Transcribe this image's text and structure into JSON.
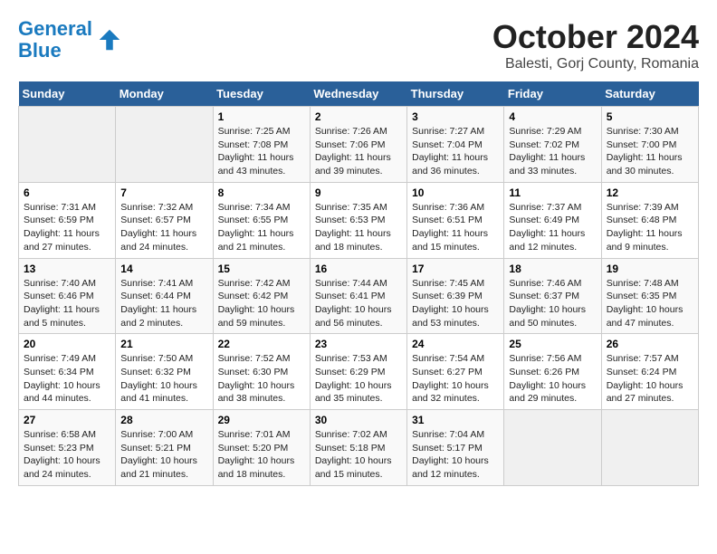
{
  "header": {
    "logo_line1": "General",
    "logo_line2": "Blue",
    "month": "October 2024",
    "location": "Balesti, Gorj County, Romania"
  },
  "days_of_week": [
    "Sunday",
    "Monday",
    "Tuesday",
    "Wednesday",
    "Thursday",
    "Friday",
    "Saturday"
  ],
  "weeks": [
    [
      {
        "day": "",
        "empty": true
      },
      {
        "day": "",
        "empty": true
      },
      {
        "day": "1",
        "sunrise": "7:25 AM",
        "sunset": "7:08 PM",
        "daylight": "11 hours and 43 minutes."
      },
      {
        "day": "2",
        "sunrise": "7:26 AM",
        "sunset": "7:06 PM",
        "daylight": "11 hours and 39 minutes."
      },
      {
        "day": "3",
        "sunrise": "7:27 AM",
        "sunset": "7:04 PM",
        "daylight": "11 hours and 36 minutes."
      },
      {
        "day": "4",
        "sunrise": "7:29 AM",
        "sunset": "7:02 PM",
        "daylight": "11 hours and 33 minutes."
      },
      {
        "day": "5",
        "sunrise": "7:30 AM",
        "sunset": "7:00 PM",
        "daylight": "11 hours and 30 minutes."
      }
    ],
    [
      {
        "day": "6",
        "sunrise": "7:31 AM",
        "sunset": "6:59 PM",
        "daylight": "11 hours and 27 minutes."
      },
      {
        "day": "7",
        "sunrise": "7:32 AM",
        "sunset": "6:57 PM",
        "daylight": "11 hours and 24 minutes."
      },
      {
        "day": "8",
        "sunrise": "7:34 AM",
        "sunset": "6:55 PM",
        "daylight": "11 hours and 21 minutes."
      },
      {
        "day": "9",
        "sunrise": "7:35 AM",
        "sunset": "6:53 PM",
        "daylight": "11 hours and 18 minutes."
      },
      {
        "day": "10",
        "sunrise": "7:36 AM",
        "sunset": "6:51 PM",
        "daylight": "11 hours and 15 minutes."
      },
      {
        "day": "11",
        "sunrise": "7:37 AM",
        "sunset": "6:49 PM",
        "daylight": "11 hours and 12 minutes."
      },
      {
        "day": "12",
        "sunrise": "7:39 AM",
        "sunset": "6:48 PM",
        "daylight": "11 hours and 9 minutes."
      }
    ],
    [
      {
        "day": "13",
        "sunrise": "7:40 AM",
        "sunset": "6:46 PM",
        "daylight": "11 hours and 5 minutes."
      },
      {
        "day": "14",
        "sunrise": "7:41 AM",
        "sunset": "6:44 PM",
        "daylight": "11 hours and 2 minutes."
      },
      {
        "day": "15",
        "sunrise": "7:42 AM",
        "sunset": "6:42 PM",
        "daylight": "10 hours and 59 minutes."
      },
      {
        "day": "16",
        "sunrise": "7:44 AM",
        "sunset": "6:41 PM",
        "daylight": "10 hours and 56 minutes."
      },
      {
        "day": "17",
        "sunrise": "7:45 AM",
        "sunset": "6:39 PM",
        "daylight": "10 hours and 53 minutes."
      },
      {
        "day": "18",
        "sunrise": "7:46 AM",
        "sunset": "6:37 PM",
        "daylight": "10 hours and 50 minutes."
      },
      {
        "day": "19",
        "sunrise": "7:48 AM",
        "sunset": "6:35 PM",
        "daylight": "10 hours and 47 minutes."
      }
    ],
    [
      {
        "day": "20",
        "sunrise": "7:49 AM",
        "sunset": "6:34 PM",
        "daylight": "10 hours and 44 minutes."
      },
      {
        "day": "21",
        "sunrise": "7:50 AM",
        "sunset": "6:32 PM",
        "daylight": "10 hours and 41 minutes."
      },
      {
        "day": "22",
        "sunrise": "7:52 AM",
        "sunset": "6:30 PM",
        "daylight": "10 hours and 38 minutes."
      },
      {
        "day": "23",
        "sunrise": "7:53 AM",
        "sunset": "6:29 PM",
        "daylight": "10 hours and 35 minutes."
      },
      {
        "day": "24",
        "sunrise": "7:54 AM",
        "sunset": "6:27 PM",
        "daylight": "10 hours and 32 minutes."
      },
      {
        "day": "25",
        "sunrise": "7:56 AM",
        "sunset": "6:26 PM",
        "daylight": "10 hours and 29 minutes."
      },
      {
        "day": "26",
        "sunrise": "7:57 AM",
        "sunset": "6:24 PM",
        "daylight": "10 hours and 27 minutes."
      }
    ],
    [
      {
        "day": "27",
        "sunrise": "6:58 AM",
        "sunset": "5:23 PM",
        "daylight": "10 hours and 24 minutes."
      },
      {
        "day": "28",
        "sunrise": "7:00 AM",
        "sunset": "5:21 PM",
        "daylight": "10 hours and 21 minutes."
      },
      {
        "day": "29",
        "sunrise": "7:01 AM",
        "sunset": "5:20 PM",
        "daylight": "10 hours and 18 minutes."
      },
      {
        "day": "30",
        "sunrise": "7:02 AM",
        "sunset": "5:18 PM",
        "daylight": "10 hours and 15 minutes."
      },
      {
        "day": "31",
        "sunrise": "7:04 AM",
        "sunset": "5:17 PM",
        "daylight": "10 hours and 12 minutes."
      },
      {
        "day": "",
        "empty": true
      },
      {
        "day": "",
        "empty": true
      }
    ]
  ]
}
